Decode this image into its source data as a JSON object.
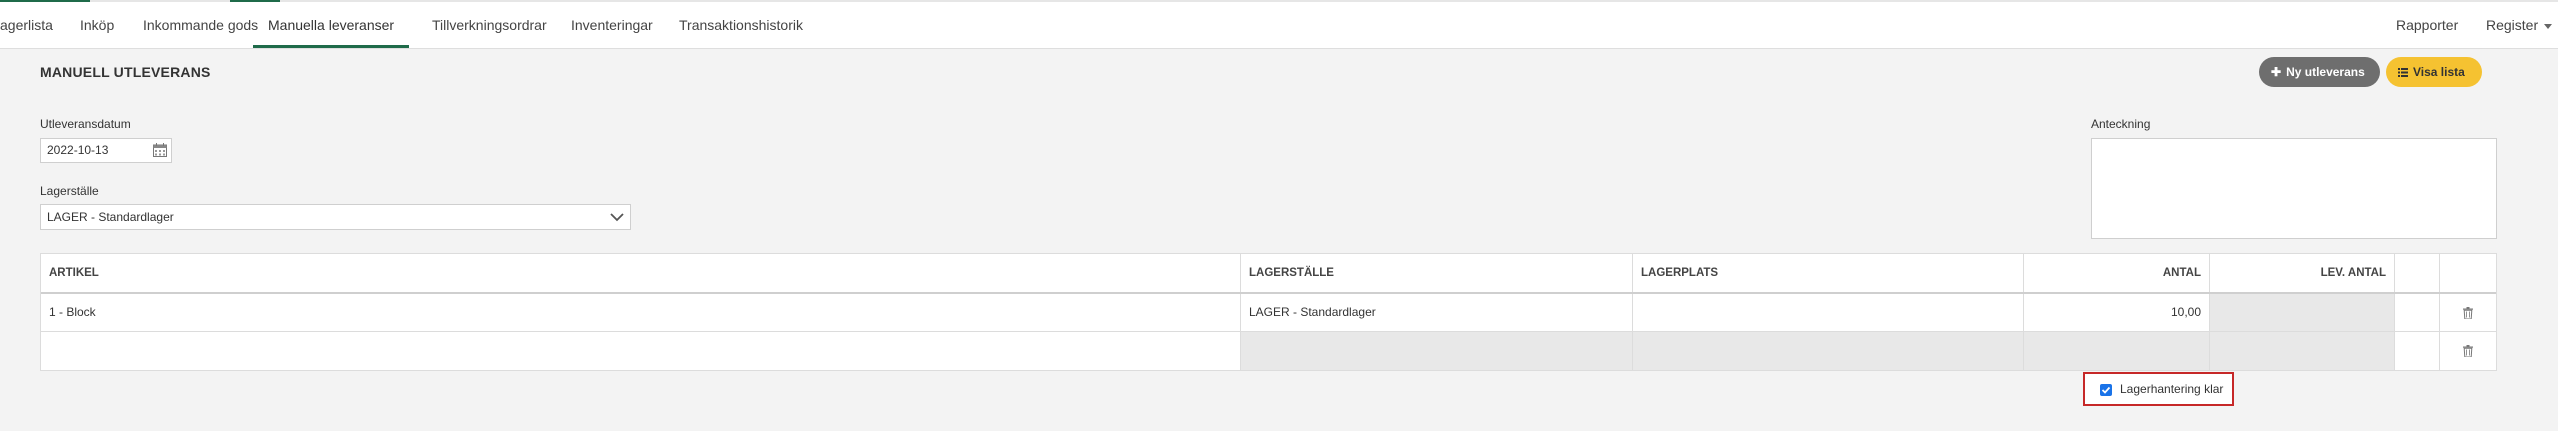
{
  "nav": {
    "tabs": [
      {
        "label": "agerlista"
      },
      {
        "label": "Inköp"
      },
      {
        "label": "Inkommande gods"
      },
      {
        "label": "Manuella leveranser"
      },
      {
        "label": "Tillverkningsordrar"
      },
      {
        "label": "Inventeringar"
      },
      {
        "label": "Transaktionshistorik"
      }
    ],
    "reports": "Rapporter",
    "register": "Register"
  },
  "page": {
    "title": "MANUELL UTLEVERANS",
    "new_button": "Ny utleverans",
    "list_button": "Visa lista"
  },
  "form": {
    "date_label": "Utleveransdatum",
    "date_value": "2022-10-13",
    "location_label": "Lagerställe",
    "location_value": "LAGER - Standardlager",
    "note_label": "Anteckning",
    "note_value": ""
  },
  "table": {
    "columns": [
      "ARTIKEL",
      "LAGERSTÄLLE",
      "LAGERPLATS",
      "ANTAL",
      "LEV. ANTAL"
    ],
    "rows": [
      {
        "artikel": "1 - Block",
        "lagerstalle": "LAGER - Standardlager",
        "lagerplats": "",
        "antal": "10,00",
        "lev_antal": ""
      },
      {
        "artikel": "",
        "lagerstalle": "",
        "lagerplats": "",
        "antal": "",
        "lev_antal": ""
      }
    ]
  },
  "footer": {
    "checkbox_label": "Lagerhantering klar",
    "checked": true
  },
  "colors": {
    "accent_green": "#1f6b4a",
    "button_gray": "#6e6e6e",
    "button_yellow": "#f5c231",
    "highlight_red": "#c62828",
    "checkbox_blue": "#1a73e8"
  }
}
